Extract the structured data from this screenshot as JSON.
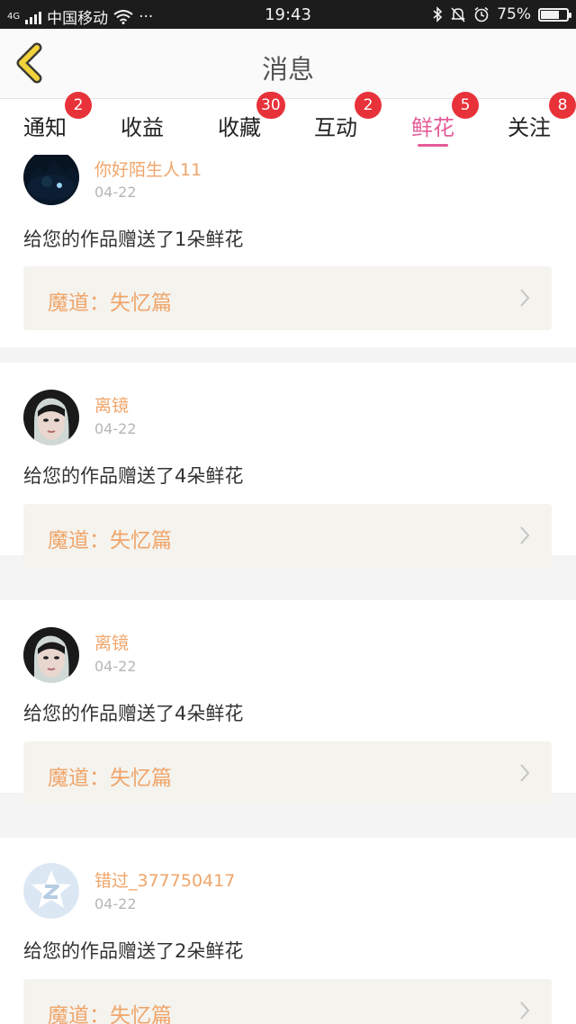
{
  "status_bar": {
    "network": "4G",
    "carrier": "中国移动",
    "more": "···",
    "time": "19:43",
    "battery": "75%",
    "battery_level": 0.75
  },
  "header": {
    "title": "消息",
    "back_icon": "chevron-left-icon"
  },
  "tabs": [
    {
      "label": "通知",
      "badge": "2"
    },
    {
      "label": "收益",
      "badge": ""
    },
    {
      "label": "收藏",
      "badge": "30"
    },
    {
      "label": "互动",
      "badge": "2"
    },
    {
      "label": "鲜花",
      "badge": "5",
      "active": true
    },
    {
      "label": "关注",
      "badge": "8"
    }
  ],
  "colors": {
    "accent_pink": "#e45c97",
    "badge_red": "#e8323a",
    "username_orange": "#f0a56a",
    "link_bg": "#f4f3ee"
  },
  "messages": [
    {
      "username": "你好陌生人11",
      "date": "04-22",
      "text": "给您的作品赠送了1朵鲜花",
      "work_title": "魔道：失忆篇",
      "avatar": "dark-night-avatar"
    },
    {
      "username": "离镜",
      "date": "04-22",
      "text": "给您的作品赠送了4朵鲜花",
      "work_title": "魔道：失忆篇",
      "avatar": "girl-portrait-avatar"
    },
    {
      "username": "离镜",
      "date": "04-22",
      "text": "给您的作品赠送了4朵鲜花",
      "work_title": "魔道：失忆篇",
      "avatar": "girl-portrait-avatar"
    },
    {
      "username": "错过_377750417",
      "date": "04-22",
      "text": "给您的作品赠送了2朵鲜花",
      "work_title": "魔道：失忆篇",
      "avatar": "default-qq-avatar"
    }
  ]
}
